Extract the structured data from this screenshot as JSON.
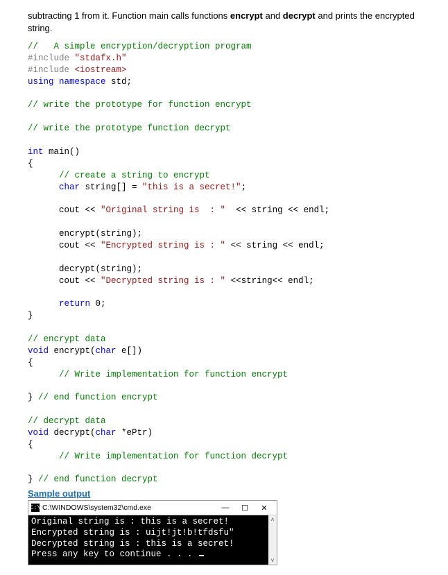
{
  "intro": {
    "line1_pre": "subtracting 1 from it. Function main calls functions ",
    "bold1": "encrypt",
    "mid": " and ",
    "bold2": "decrypt",
    "line1_post": " and prints the encrypted string."
  },
  "code": {
    "c01": "//   A simple encryption/decryption program",
    "c02a": "#include ",
    "c02b": "\"stdafx.h\"",
    "c03a": "#include ",
    "c03b": "<iostream>",
    "c04a": "using",
    "c04b": " namespace",
    "c04c": " std;",
    "c06": "// write the prototype for function encrypt",
    "c08": "// write the prototype function decrypt",
    "c10a": "int",
    "c10b": " main()",
    "c11": "{",
    "c12": "      // create a string to encrypt",
    "c13a": "      char",
    "c13b": " string[] = ",
    "c13c": "\"this is a secret!\"",
    "c13d": ";",
    "c15a": "      cout << ",
    "c15b": "\"Original string is  : \"",
    "c15c": "  << string << endl;",
    "c17": "      encrypt(string);",
    "c18a": "      cout << ",
    "c18b": "\"Encrypted string is : \"",
    "c18c": " << string << endl;",
    "c20": "      decrypt(string);",
    "c21a": "      cout << ",
    "c21b": "\"Decrypted string is : \"",
    "c21c": " <<string<< endl;",
    "c23a": "      return",
    "c23b": " 0;",
    "c24": "}",
    "c26": "// encrypt data",
    "c27a": "void",
    "c27b": " encrypt(",
    "c27c": "char",
    "c27d": " e[])",
    "c28": "{",
    "c29": "      // Write implementation for function encrypt",
    "c31": "} ",
    "c31b": "// end function encrypt",
    "c33": "// decrypt data",
    "c34a": "void",
    "c34b": " decrypt(",
    "c34c": "char",
    "c34d": " *ePtr)",
    "c35": "{",
    "c36": "      // Write implementation for function decrypt",
    "c38": "} ",
    "c38b": "// end function decrypt"
  },
  "sample_heading": "Sample output",
  "console": {
    "icon": "C:\\",
    "title": "C:\\WINDOWS\\system32\\cmd.exe",
    "btn_min": "—",
    "btn_max": "☐",
    "btn_close": "✕",
    "lines": {
      "l1": "Original string is  : this is a secret!",
      "l2": "Encrypted string is : uijt!jt!b!tfdsfu\"",
      "l3": "Decrypted string is : this is a secret!",
      "l4": "Press any key to continue . . . "
    },
    "scroll_up": "˄",
    "scroll_dn": "˅"
  }
}
